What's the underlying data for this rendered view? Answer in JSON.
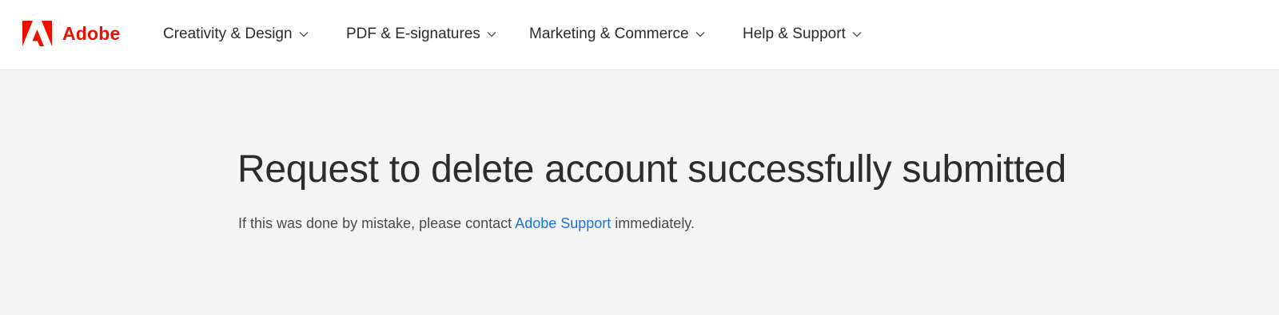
{
  "header": {
    "logo_text": "Adobe",
    "brand_color": "#eb1000",
    "nav": [
      {
        "label": "Creativity & Design",
        "icon": "chevron-down-icon"
      },
      {
        "label": "PDF & E-signatures",
        "icon": "chevron-down-icon"
      },
      {
        "label": "Marketing & Commerce",
        "icon": "chevron-down-icon"
      },
      {
        "label": "Help & Support",
        "icon": "chevron-down-icon"
      }
    ]
  },
  "main": {
    "title": "Request to delete account successfully submitted",
    "message_prefix": "If this was done by mistake, please contact ",
    "support_link": "Adobe Support",
    "message_suffix": " immediately.",
    "link_color": "#1473e6"
  }
}
